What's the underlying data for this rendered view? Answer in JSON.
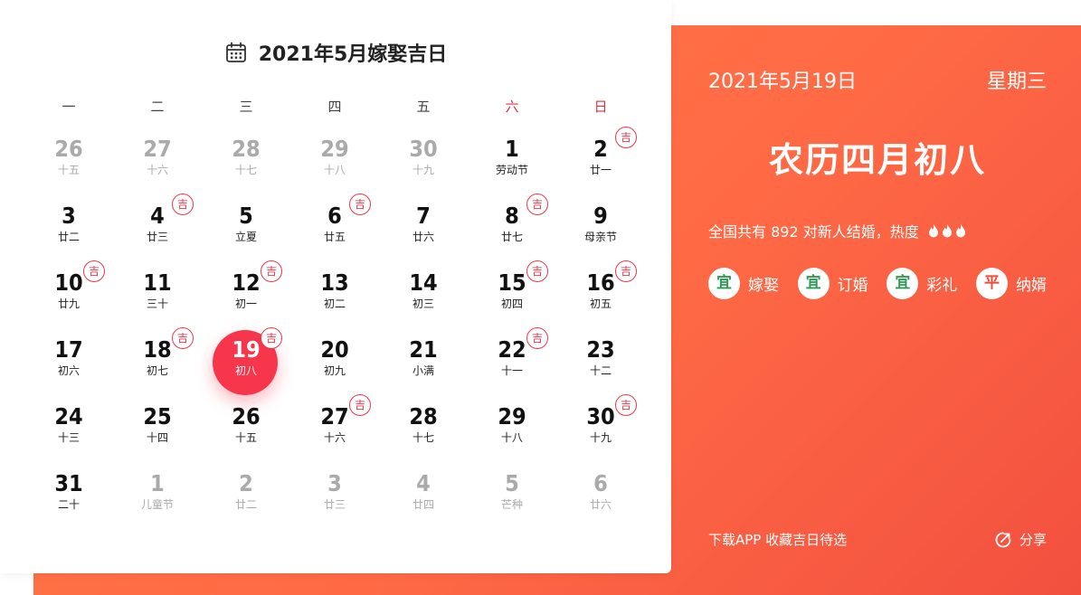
{
  "calendar": {
    "title": "2021年5月嫁娶吉日",
    "icon": "calendar-icon",
    "weekdays": [
      {
        "label": "一",
        "weekend": false
      },
      {
        "label": "二",
        "weekend": false
      },
      {
        "label": "三",
        "weekend": false
      },
      {
        "label": "四",
        "weekend": false
      },
      {
        "label": "五",
        "weekend": false
      },
      {
        "label": "六",
        "weekend": true
      },
      {
        "label": "日",
        "weekend": true
      }
    ],
    "auspicious_label": "吉",
    "days": [
      {
        "day": "26",
        "lunar": "十五",
        "muted": true,
        "auspicious": false
      },
      {
        "day": "27",
        "lunar": "十六",
        "muted": true,
        "auspicious": false
      },
      {
        "day": "28",
        "lunar": "十七",
        "muted": true,
        "auspicious": false
      },
      {
        "day": "29",
        "lunar": "十八",
        "muted": true,
        "auspicious": false
      },
      {
        "day": "30",
        "lunar": "十九",
        "muted": true,
        "auspicious": false
      },
      {
        "day": "1",
        "lunar": "劳动节",
        "muted": false,
        "auspicious": false
      },
      {
        "day": "2",
        "lunar": "廿一",
        "muted": false,
        "auspicious": true
      },
      {
        "day": "3",
        "lunar": "廿二",
        "muted": false,
        "auspicious": false
      },
      {
        "day": "4",
        "lunar": "廿三",
        "muted": false,
        "auspicious": true
      },
      {
        "day": "5",
        "lunar": "立夏",
        "muted": false,
        "auspicious": false
      },
      {
        "day": "6",
        "lunar": "廿五",
        "muted": false,
        "auspicious": true
      },
      {
        "day": "7",
        "lunar": "廿六",
        "muted": false,
        "auspicious": false
      },
      {
        "day": "8",
        "lunar": "廿七",
        "muted": false,
        "auspicious": true
      },
      {
        "day": "9",
        "lunar": "母亲节",
        "muted": false,
        "auspicious": false
      },
      {
        "day": "10",
        "lunar": "廿九",
        "muted": false,
        "auspicious": true
      },
      {
        "day": "11",
        "lunar": "三十",
        "muted": false,
        "auspicious": false
      },
      {
        "day": "12",
        "lunar": "初一",
        "muted": false,
        "auspicious": true
      },
      {
        "day": "13",
        "lunar": "初二",
        "muted": false,
        "auspicious": false
      },
      {
        "day": "14",
        "lunar": "初三",
        "muted": false,
        "auspicious": false
      },
      {
        "day": "15",
        "lunar": "初四",
        "muted": false,
        "auspicious": true
      },
      {
        "day": "16",
        "lunar": "初五",
        "muted": false,
        "auspicious": true
      },
      {
        "day": "17",
        "lunar": "初六",
        "muted": false,
        "auspicious": false
      },
      {
        "day": "18",
        "lunar": "初七",
        "muted": false,
        "auspicious": true
      },
      {
        "day": "19",
        "lunar": "初八",
        "muted": false,
        "auspicious": true,
        "selected": true
      },
      {
        "day": "20",
        "lunar": "初九",
        "muted": false,
        "auspicious": false
      },
      {
        "day": "21",
        "lunar": "小满",
        "muted": false,
        "auspicious": false
      },
      {
        "day": "22",
        "lunar": "十一",
        "muted": false,
        "auspicious": true
      },
      {
        "day": "23",
        "lunar": "十二",
        "muted": false,
        "auspicious": false
      },
      {
        "day": "24",
        "lunar": "十三",
        "muted": false,
        "auspicious": false
      },
      {
        "day": "25",
        "lunar": "十四",
        "muted": false,
        "auspicious": false
      },
      {
        "day": "26",
        "lunar": "十五",
        "muted": false,
        "auspicious": false
      },
      {
        "day": "27",
        "lunar": "十六",
        "muted": false,
        "auspicious": true
      },
      {
        "day": "28",
        "lunar": "十七",
        "muted": false,
        "auspicious": false
      },
      {
        "day": "29",
        "lunar": "十八",
        "muted": false,
        "auspicious": false
      },
      {
        "day": "30",
        "lunar": "十九",
        "muted": false,
        "auspicious": true
      },
      {
        "day": "31",
        "lunar": "二十",
        "muted": false,
        "auspicious": false
      },
      {
        "day": "1",
        "lunar": "儿童节",
        "muted": true,
        "auspicious": false
      },
      {
        "day": "2",
        "lunar": "廿二",
        "muted": true,
        "auspicious": false
      },
      {
        "day": "3",
        "lunar": "廿三",
        "muted": true,
        "auspicious": false
      },
      {
        "day": "4",
        "lunar": "廿四",
        "muted": true,
        "auspicious": false
      },
      {
        "day": "5",
        "lunar": "芒种",
        "muted": true,
        "auspicious": false
      },
      {
        "day": "6",
        "lunar": "廿六",
        "muted": true,
        "auspicious": false
      }
    ]
  },
  "info": {
    "date": "2021年5月19日",
    "weekday": "星期三",
    "lunar_date": "农历四月初八",
    "stats_text": "全国共有 892 对新人结婚，热度",
    "heat_icon": "flame-icon",
    "heat_level": 3,
    "tags": [
      {
        "badge": "宜",
        "label": "嫁娶",
        "kind": "good"
      },
      {
        "badge": "宜",
        "label": "订婚",
        "kind": "good"
      },
      {
        "badge": "宜",
        "label": "彩礼",
        "kind": "good"
      },
      {
        "badge": "平",
        "label": "纳婿",
        "kind": "neutral"
      }
    ],
    "footer_text": "下载APP 收藏吉日待选",
    "share_label": "分享",
    "share_icon": "share-icon"
  },
  "colors": {
    "accent": "#ff7a45",
    "selected": "#f7364c",
    "auspicious": "#e8394a",
    "weekend": "#e03040",
    "good": "#2e9a55"
  }
}
